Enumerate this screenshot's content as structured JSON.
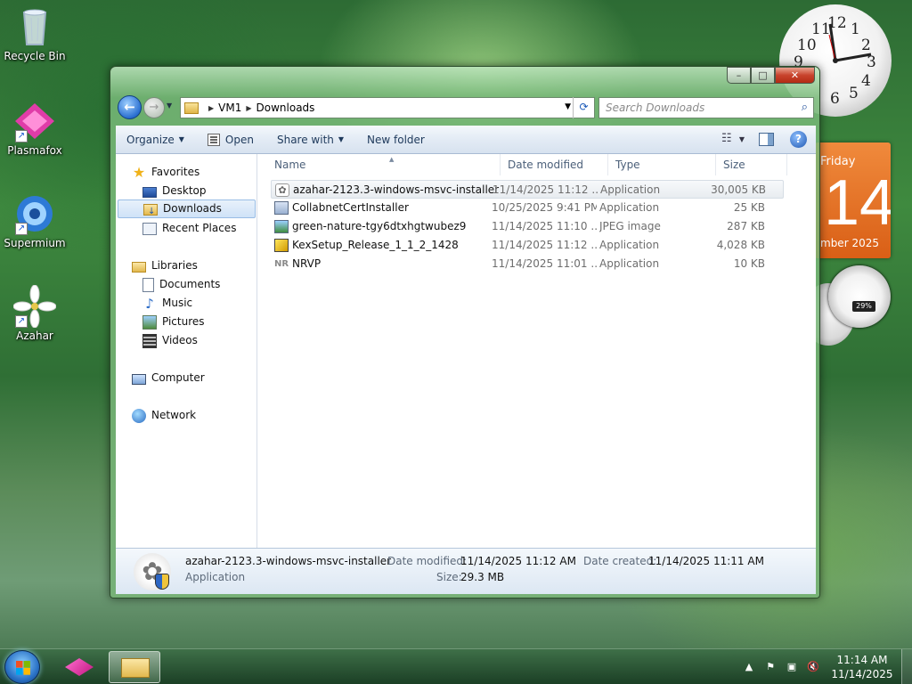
{
  "desktop": {
    "icons": [
      {
        "label": "Recycle Bin"
      },
      {
        "label": "Plasmafox"
      },
      {
        "label": "Supermium"
      },
      {
        "label": "Azahar"
      }
    ]
  },
  "gadgets": {
    "clock": {
      "numerals": [
        "10",
        "11",
        "12",
        "1",
        "2",
        "3",
        "4",
        "5",
        "6",
        "9"
      ]
    },
    "calendar": {
      "day_name": "Friday",
      "day_number": "14",
      "month_fragment": "mber 2025"
    },
    "meter": {
      "percent": "29%"
    }
  },
  "window": {
    "title": "Downloads",
    "caption": {
      "minimize": "–",
      "maximize": "□",
      "close": "✕"
    },
    "address": {
      "crumbs": [
        "VM1",
        "Downloads"
      ]
    },
    "search": {
      "placeholder": "Search Downloads"
    },
    "toolbar": {
      "organize": "Organize",
      "open": "Open",
      "share_with": "Share with",
      "new_folder": "New folder"
    },
    "nav_pane": {
      "favorites": "Favorites",
      "desktop": "Desktop",
      "downloads": "Downloads",
      "recent_places": "Recent Places",
      "libraries": "Libraries",
      "documents": "Documents",
      "music": "Music",
      "pictures": "Pictures",
      "videos": "Videos",
      "computer": "Computer",
      "network": "Network"
    },
    "columns": {
      "name": "Name",
      "date_modified": "Date modified",
      "type": "Type",
      "size": "Size"
    },
    "files": [
      {
        "name": "azahar-2123.3-windows-msvc-installer",
        "date": "11/14/2025 11:12 ...",
        "type": "Application",
        "size": "30,005 KB",
        "icon": "azahar-installer-icon"
      },
      {
        "name": "CollabnetCertInstaller",
        "date": "10/25/2025 9:41 PM",
        "type": "Application",
        "size": "25 KB",
        "icon": "installer-icon"
      },
      {
        "name": "green-nature-tgy6dtxhgtwubez9",
        "date": "11/14/2025 11:10 ...",
        "type": "JPEG image",
        "size": "287 KB",
        "icon": "jpeg-image-icon"
      },
      {
        "name": "KexSetup_Release_1_1_2_1428",
        "date": "11/14/2025 11:12 ...",
        "type": "Application",
        "size": "4,028 KB",
        "icon": "setup-icon"
      },
      {
        "name": "NRVP",
        "date": "11/14/2025 11:01 ...",
        "type": "Application",
        "size": "10 KB",
        "icon": "nr-app-icon",
        "icon_text": "NR"
      }
    ],
    "details": {
      "name": "azahar-2123.3-windows-msvc-installer",
      "type": "Application",
      "date_modified_label": "Date modified:",
      "date_modified": "11/14/2025 11:12 AM",
      "date_created_label": "Date created:",
      "date_created": "11/14/2025 11:11 AM",
      "size_label": "Size:",
      "size": "29.3 MB"
    }
  },
  "taskbar": {
    "time": "11:14 AM",
    "date": "11/14/2025"
  }
}
